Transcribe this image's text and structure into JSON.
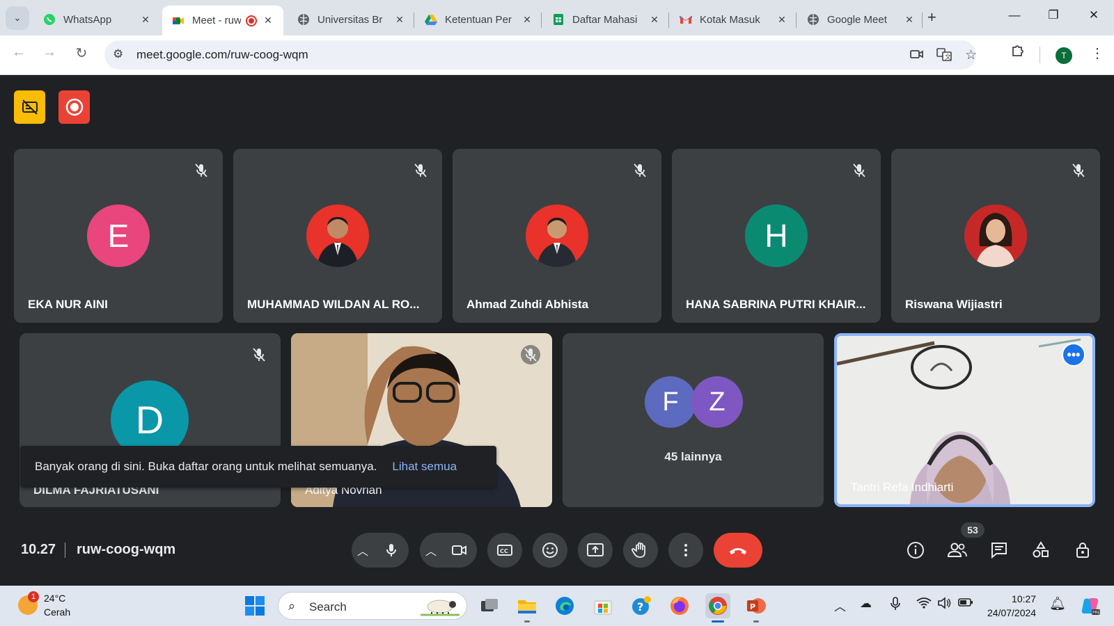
{
  "browser": {
    "tabs": [
      {
        "label": "WhatsApp",
        "icon": "whatsapp-icon",
        "active": false
      },
      {
        "label": "Meet - ruw",
        "icon": "google-meet-icon",
        "active": true
      },
      {
        "label": "Universitas Br",
        "icon": "globe-icon",
        "active": false
      },
      {
        "label": "Ketentuan Per",
        "icon": "google-drive-icon",
        "active": false
      },
      {
        "label": "Daftar Mahasi",
        "icon": "google-sheets-icon",
        "active": false
      },
      {
        "label": "Kotak Masuk",
        "icon": "gmail-icon",
        "active": false
      },
      {
        "label": "Google Meet",
        "icon": "globe-icon",
        "active": false
      }
    ],
    "url": "meet.google.com/ruw-coog-wqm",
    "profile_initial": "T"
  },
  "meeting": {
    "participants": [
      {
        "name": "EKA NUR AINI",
        "initial": "E",
        "color": "#e8467c",
        "muted": true
      },
      {
        "name": "MUHAMMAD WILDAN AL RO...",
        "initial": "",
        "color": "#e8322a",
        "muted": true
      },
      {
        "name": "Ahmad Zuhdi Abhista",
        "initial": "",
        "color": "#e8322a",
        "muted": true
      },
      {
        "name": "HANA SABRINA PUTRI KHAIR...",
        "initial": "H",
        "color": "#0b8a72",
        "muted": true
      },
      {
        "name": "Riswana Wijiastri",
        "initial": "",
        "color": "#c62828",
        "muted": true
      },
      {
        "name": "DILMA FAJRIATUSANI",
        "initial": "D",
        "color": "#0a97a8",
        "muted": true
      },
      {
        "name": "Aditya Novrian",
        "initial": "",
        "color": "",
        "muted": true
      },
      {
        "name": "Tantri Refa Indhiarti",
        "initial": "",
        "color": "",
        "muted": false
      }
    ],
    "others": {
      "initials": [
        "F",
        "Z"
      ],
      "colors": [
        "#5c6bc0",
        "#7e57c2"
      ],
      "label": "45 lainnya"
    },
    "toast": {
      "message": "Banyak orang di sini. Buka daftar orang untuk melihat semuanya.",
      "link": "Lihat semua"
    },
    "time": "10.27",
    "code": "ruw-coog-wqm",
    "people_count": "53"
  },
  "taskbar": {
    "weather": {
      "temp": "24°C",
      "condition": "Cerah",
      "notification": "1"
    },
    "search_placeholder": "Search",
    "clock_time": "10:27",
    "clock_date": "24/07/2024"
  },
  "colors": {
    "accent": "#8ab4f8",
    "end_call": "#ea4335",
    "tile_bg": "#3c4043",
    "page_bg": "#202124"
  }
}
